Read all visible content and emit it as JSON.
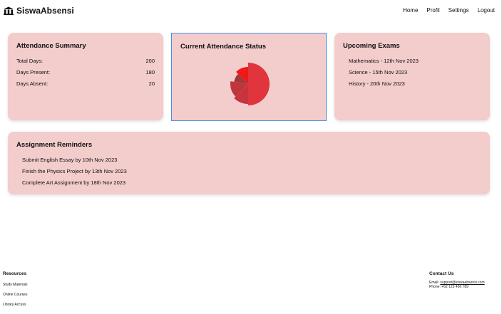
{
  "navbar": {
    "brand": "SiswaAbsensi",
    "brand_icon": "building-columns-icon",
    "links": [
      "Home",
      "Profil",
      "Settings",
      "Logout"
    ]
  },
  "attendance_summary": {
    "title": "Attendance Summary",
    "rows": [
      {
        "label": "Total Days:",
        "value": "200"
      },
      {
        "label": "Days Present:",
        "value": "180"
      },
      {
        "label": "Days Absent:",
        "value": "20"
      }
    ]
  },
  "attendance_status": {
    "title": "Current Attendance Status",
    "chart_data": {
      "type": "pie",
      "slices": [
        {
          "value": 40,
          "color": "#e0353d"
        },
        {
          "value": 10,
          "color": "#f01818"
        },
        {
          "value": 8,
          "color": "#9e3a3e"
        },
        {
          "value": 12,
          "color": "#c0353a"
        },
        {
          "value": 10,
          "color": "#c7343d"
        }
      ]
    }
  },
  "upcoming_exams": {
    "title": "Upcoming Exams",
    "items": [
      "Mathematics - 12th Nov 2023",
      "Science - 15th Nov 2023",
      "History - 20th Nov 2023"
    ]
  },
  "assignment_reminders": {
    "title": "Assignment Reminders",
    "items": [
      "Submit English Essay by 10th Nov 2023",
      "Finish the Physics Project by 13th Nov 2023",
      "Complete Art Assignment by 18th Nov 2023"
    ]
  },
  "footer": {
    "resources": {
      "title": "Resources",
      "links": [
        "Study Materials",
        "Online Courses",
        "Library Access"
      ]
    },
    "contact": {
      "title": "Contact Us",
      "email_label": "Email:",
      "email": "support@siswaabsensi.com",
      "phone": "Phone: +62 123 456 789"
    }
  },
  "colors": {
    "card_bg": "#f3cccc",
    "focus_border": "#4a90e2"
  }
}
